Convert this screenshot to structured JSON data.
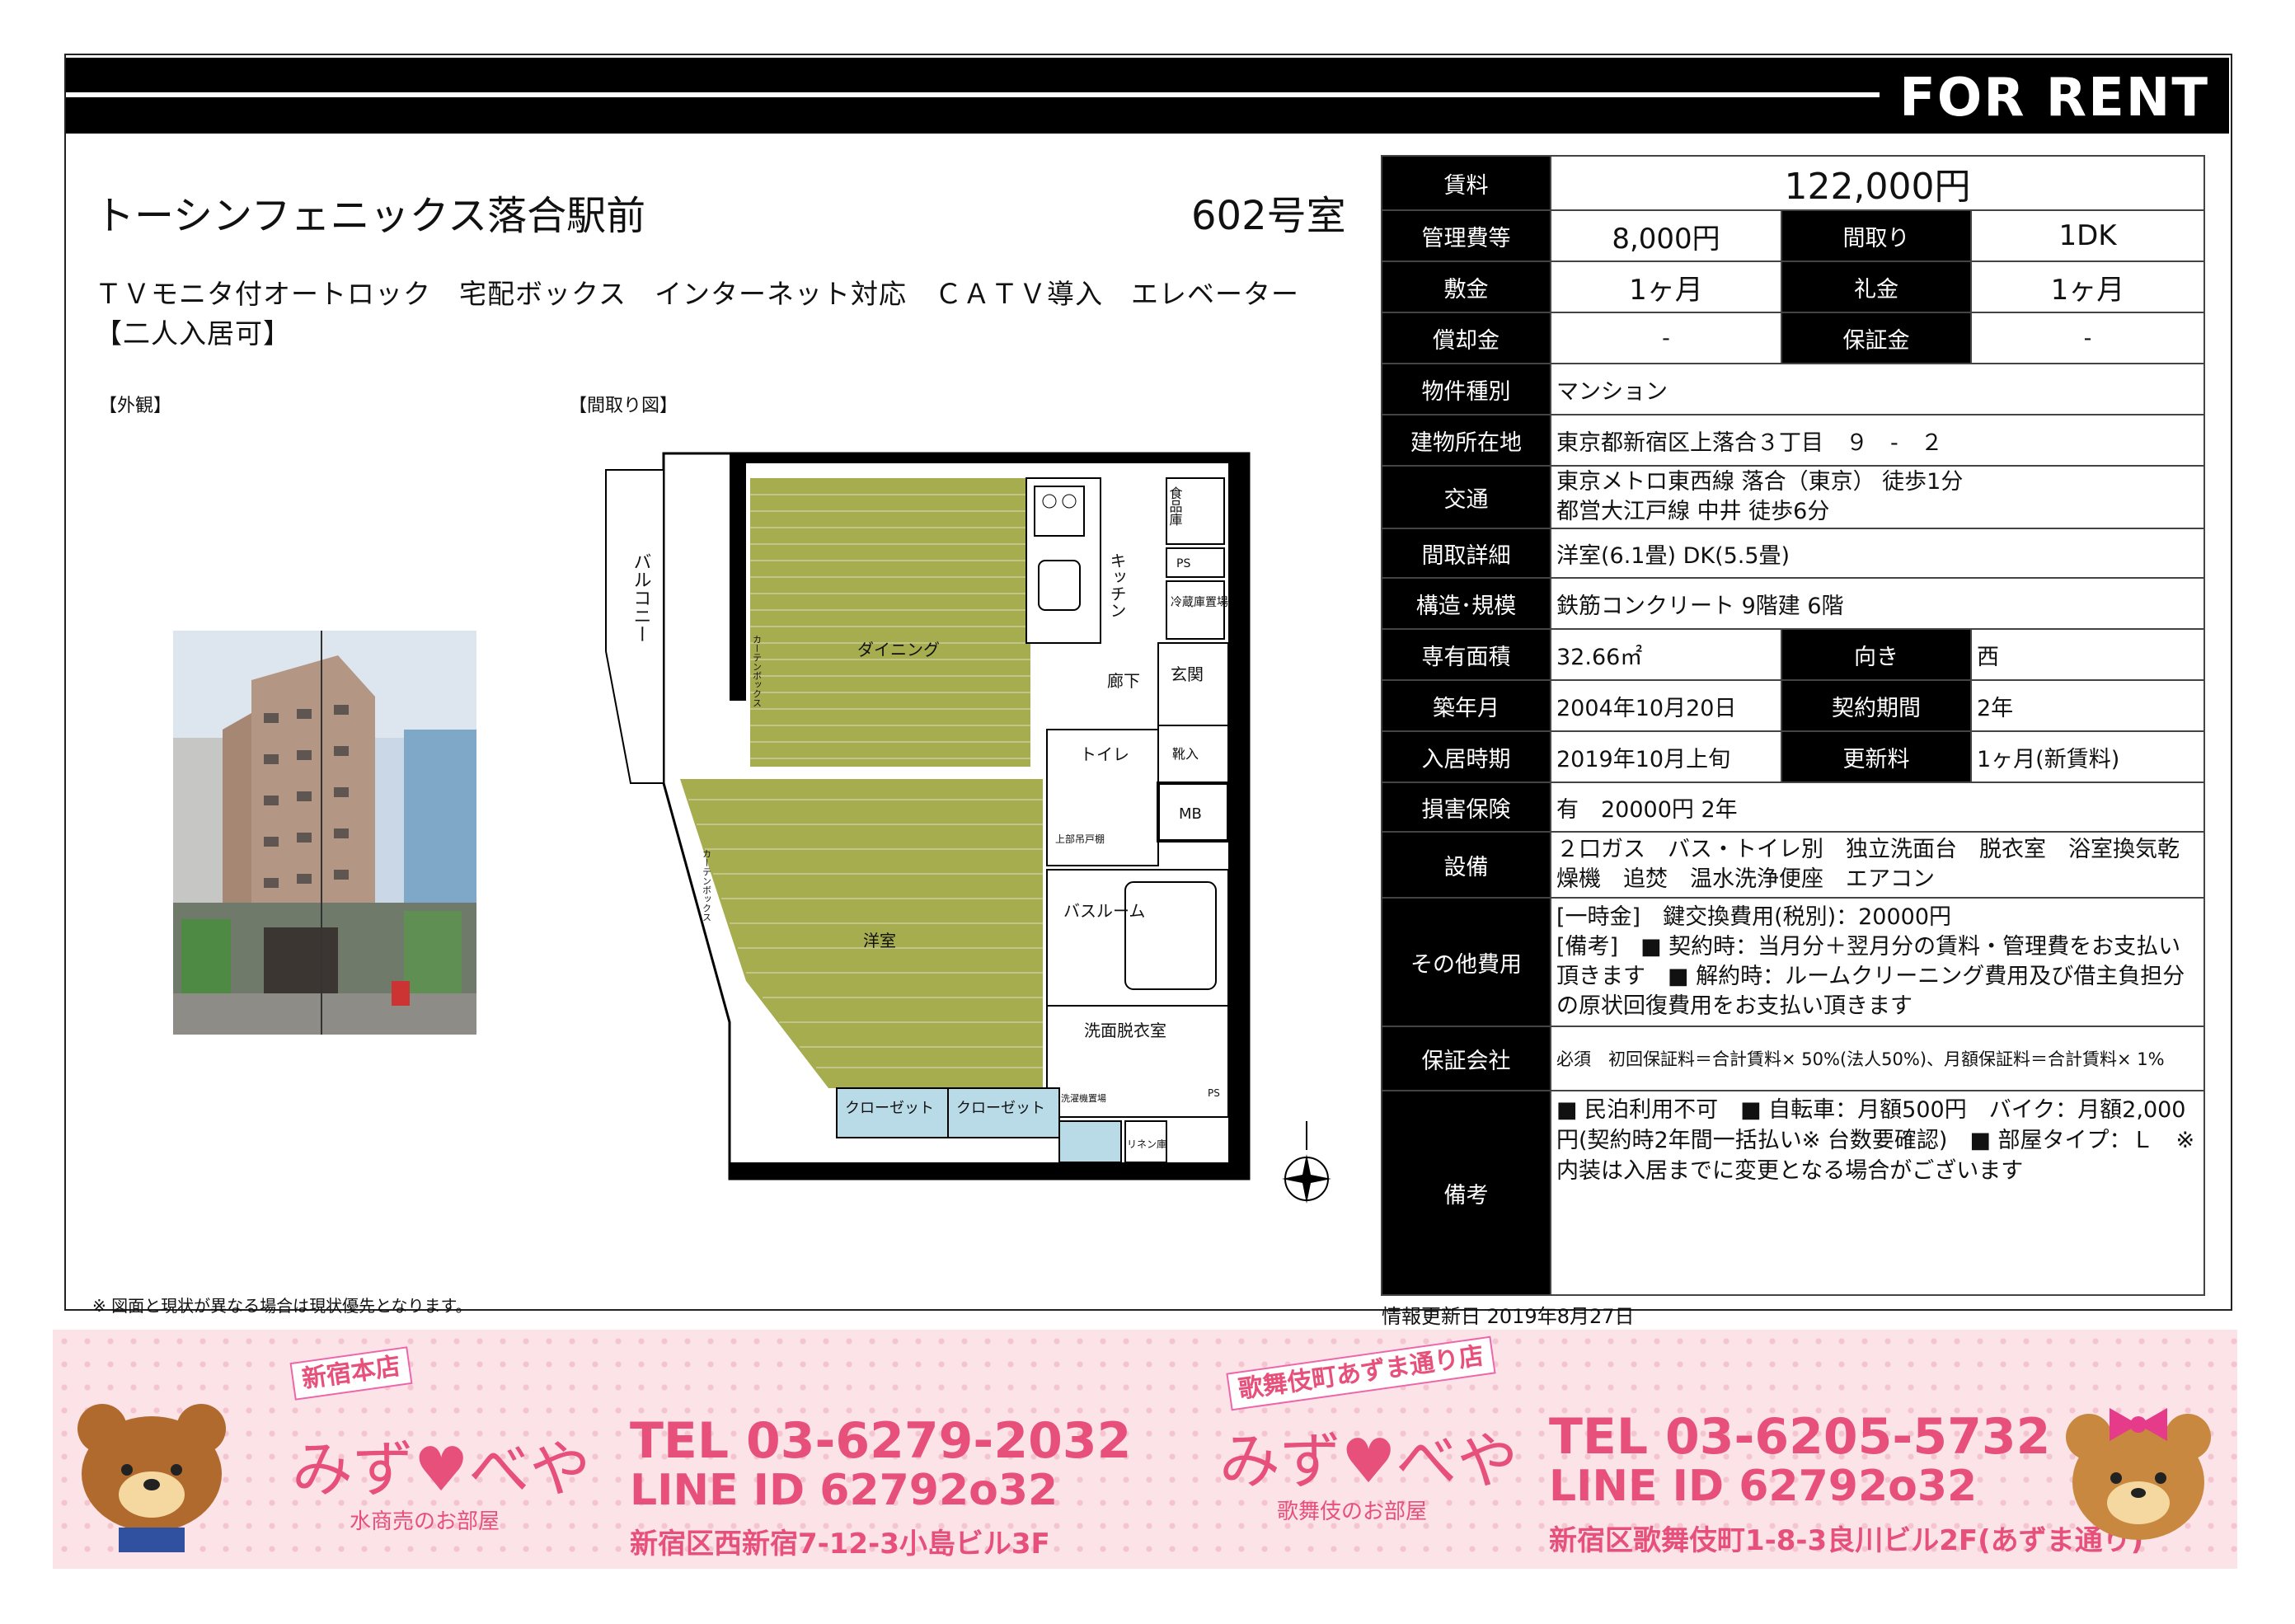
{
  "header": {
    "label": "FOR RENT"
  },
  "property": {
    "title": "トーシンフェニックス落合駅前",
    "room": "602号室",
    "features_line1": "ＴＶモニタ付オートロック　宅配ボックス　インターネット対応　ＣＡＴＶ導入　エレベーター",
    "features_line2": "【二人入居可】"
  },
  "captions": {
    "exterior": "【外観】",
    "floorplan": "【間取り図】"
  },
  "floorplan_labels": {
    "balcony": "バルコニー",
    "dining": "ダイニング",
    "kitchen": "キッチン",
    "pantry": "食品庫",
    "fridge": "冷蔵庫置場",
    "hall": "廊下",
    "entrance": "玄関",
    "shoes": "靴入",
    "toilet": "トイレ",
    "mb": "MB",
    "bath": "バスルーム",
    "western": "洋室",
    "washroom": "洗面脱衣室",
    "closet1": "クローゼット",
    "closet2": "クローゼット",
    "linen": "リネン庫",
    "ps": "PS",
    "curtain": "カーテンボックス",
    "upper": "上部吊戸棚",
    "washer": "洗濯機置場"
  },
  "info": {
    "rent_label": "賃料",
    "rent": "122,000円",
    "mgmt_label": "管理費等",
    "mgmt": "8,000円",
    "layout_label": "間取り",
    "layout": "1DK",
    "deposit_label": "敷金",
    "deposit": "1ヶ月",
    "keymoney_label": "礼金",
    "keymoney": "1ヶ月",
    "amort_label": "償却金",
    "amort": "-",
    "guarantee_label": "保証金",
    "guarantee": "-",
    "type_label": "物件種別",
    "type": "マンション",
    "address_label": "建物所在地",
    "address": "東京都新宿区上落合３丁目　９　-　２",
    "transit_label": "交通",
    "transit1": "東京メトロ東西線 落合（東京） 徒歩1分",
    "transit2": "都営大江戸線 中井 徒歩6分",
    "rooms_label": "間取詳細",
    "rooms": "洋室(6.1畳) DK(5.5畳)",
    "structure_label": "構造･規模",
    "structure": "鉄筋コンクリート 9階建 6階",
    "area_label": "専有面積",
    "area": "32.66㎡",
    "facing_label": "向き",
    "facing": "西",
    "built_label": "築年月",
    "built": "2004年10月20日",
    "term_label": "契約期間",
    "term": "2年",
    "movein_label": "入居時期",
    "movein": "2019年10月上旬",
    "renewal_label": "更新料",
    "renewal": "1ヶ月(新賃料)",
    "insurance_label": "損害保険",
    "insurance": "有　20000円 2年",
    "equipment_label": "設備",
    "equipment": "２口ガス　バス・トイレ別　独立洗面台　脱衣室　浴室換気乾燥機　追焚　温水洗浄便座　エアコン",
    "other_label": "その他費用",
    "other1": "[一時金]　鍵交換費用(税別)：20000円",
    "other2": "[備考]　■ 契約時：当月分＋翌月分の賃料・管理費をお支払い頂きます　■ 解約時：ルームクリーニング費用及び借主負担分の原状回復費用をお支払い頂きます",
    "company_label": "保証会社",
    "company": "必須　初回保証料＝合計賃料× 50%(法人50%)、月額保証料＝合計賃料× 1%",
    "remarks_label": "備考",
    "remarks": "■ 民泊利用不可　■ 自転車：月額500円　バイク：月額2,000円(契約時2年間一括払い※ 台数要確認)　■ 部屋タイプ：Ｌ　※ 内装は入居までに変更となる場合がございます"
  },
  "footer": {
    "note": "※ 図面と現状が異なる場合は現状優先となります。",
    "updated": "情報更新日 2019年8月27日"
  },
  "banner": {
    "shop1": {
      "tag": "新宿本店",
      "logo": "みず♥べや",
      "sub": "水商売のお部屋",
      "tel": "TEL 03-6279-2032",
      "line": "LINE ID 62792o32",
      "addr": "新宿区西新宿7-12-3小島ビル3F"
    },
    "shop2": {
      "tag": "歌舞伎町あずま通り店",
      "logo": "みず♥べや",
      "sub": "歌舞伎のお部屋",
      "tel": "TEL 03-6205-5732",
      "line": "LINE ID 62792o32",
      "addr": "新宿区歌舞伎町1-8-3良川ビル2F(あずま通り)"
    }
  }
}
